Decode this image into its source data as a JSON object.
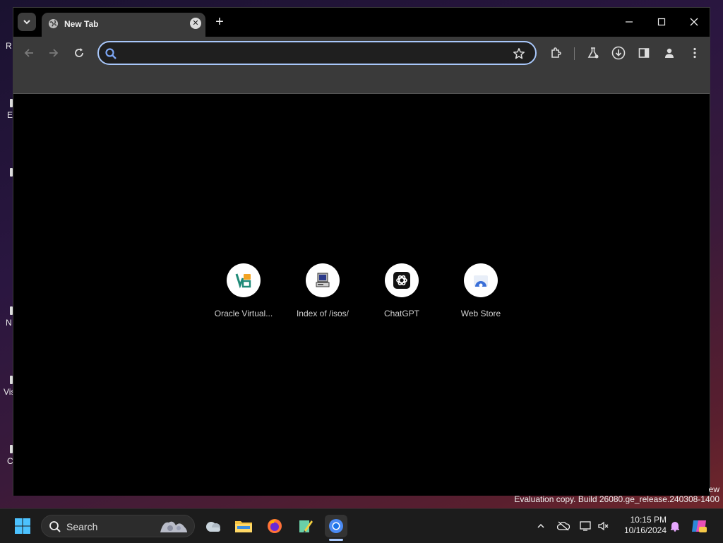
{
  "desktop": {
    "fragments": [
      "R",
      "E",
      "N",
      "Vis",
      "C"
    ]
  },
  "browser": {
    "tab": {
      "title": "New Tab",
      "close_symbol": "✕",
      "favicon": "globe-icon"
    },
    "new_tab_symbol": "+",
    "window_controls": [
      "minimize-icon",
      "maximize-icon",
      "close-icon"
    ],
    "toolbar": {
      "back": "arrow-left-icon",
      "forward": "arrow-right-icon",
      "reload": "reload-icon",
      "omnibox_value": "",
      "omnibox_placeholder": "",
      "bookmark": "star-icon",
      "extensions": "puzzle-icon",
      "labs": "flask-icon",
      "downloads": "download-icon",
      "side_panel": "side-panel-icon",
      "profile": "person-icon",
      "menu": "more-vert-icon"
    },
    "shortcuts": [
      {
        "label": "Oracle Virtual...",
        "icon": "virtualbox-icon"
      },
      {
        "label": "Index of /isos/",
        "icon": "computer-icon"
      },
      {
        "label": "ChatGPT",
        "icon": "chatgpt-icon"
      },
      {
        "label": "Web Store",
        "icon": "webstore-icon"
      }
    ]
  },
  "watermark": {
    "fragment": "ew",
    "text": "Evaluation copy. Build 26080.ge_release.240308-1400"
  },
  "taskbar": {
    "search_label": "Search",
    "clock": {
      "time": "10:15 PM",
      "date": "10/16/2024"
    }
  },
  "colors": {
    "accent": "#a8c7fa",
    "toolbar": "#3a3a3a",
    "page": "#000000"
  }
}
